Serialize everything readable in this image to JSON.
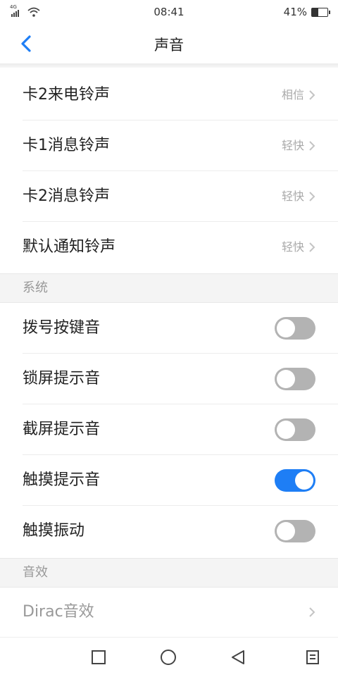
{
  "status_bar": {
    "network": "4G",
    "time": "08:41",
    "battery_percent": "41%",
    "battery_level": 0.41
  },
  "header": {
    "title": "声音",
    "back_icon": "chevron-left-icon"
  },
  "ringtones": [
    {
      "label": "卡2来电铃声",
      "value": "相信"
    },
    {
      "label": "卡1消息铃声",
      "value": "轻快"
    },
    {
      "label": "卡2消息铃声",
      "value": "轻快"
    },
    {
      "label": "默认通知铃声",
      "value": "轻快"
    }
  ],
  "system": {
    "title": "系统",
    "items": [
      {
        "label": "拨号按键音",
        "on": false
      },
      {
        "label": "锁屏提示音",
        "on": false
      },
      {
        "label": "截屏提示音",
        "on": false
      },
      {
        "label": "触摸提示音",
        "on": true
      },
      {
        "label": "触摸振动",
        "on": false
      }
    ]
  },
  "effects": {
    "title": "音效",
    "items": [
      {
        "label": "Dirac音效"
      }
    ]
  },
  "colors": {
    "accent": "#1e7ef5",
    "toggle_off": "#b3b3b3"
  },
  "nav": {
    "icons": [
      "square-icon",
      "circle-icon",
      "triangle-back-icon",
      "menu-icon"
    ]
  }
}
